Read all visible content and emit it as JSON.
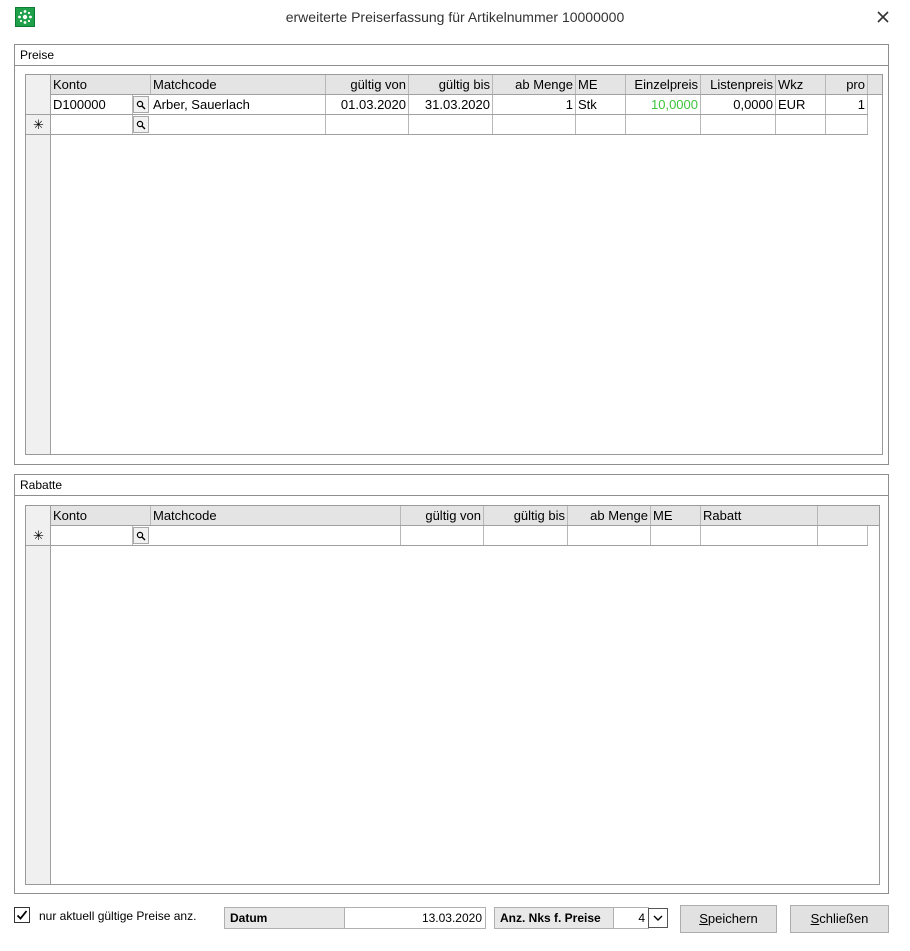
{
  "window": {
    "title": "erweiterte Preiserfassung für Artikelnummer  10000000",
    "app_icon": "app-logo-icon",
    "close_icon": "close-icon"
  },
  "preise": {
    "group_title": "Preise",
    "columns": [
      "Konto",
      "Matchcode",
      "gültig von",
      "gültig bis",
      "ab Menge",
      "ME",
      "Einzelpreis",
      "Listenpreis",
      "Wkz",
      "pro"
    ],
    "rows": [
      {
        "konto": "D100000",
        "matchcode": "Arber, Sauerlach",
        "gueltig_von": "01.03.2020",
        "gueltig_bis": "31.03.2020",
        "ab_menge": "1",
        "me": "Stk",
        "einzelpreis": "10,0000",
        "listenpreis": "0,0000",
        "wkz": "EUR",
        "pro": "1"
      }
    ],
    "new_row_marker": "✳",
    "einzelpreis_color": "#3ec43e"
  },
  "rabatte": {
    "group_title": "Rabatte",
    "columns": [
      "Konto",
      "Matchcode",
      "gültig von",
      "gültig bis",
      "ab Menge",
      "ME",
      "Rabatt"
    ],
    "new_row_marker": "✳"
  },
  "footer": {
    "checkbox_checked": true,
    "checkbox_label": "nur aktuell gültige Preise anz.",
    "datum_label": "Datum",
    "datum_value": "13.03.2020",
    "nks_label": "Anz. Nks f. Preise",
    "nks_value": "4",
    "save_prefix": "S",
    "save_rest": "peichern",
    "close_prefix": "S",
    "close_rest": "chließen"
  }
}
